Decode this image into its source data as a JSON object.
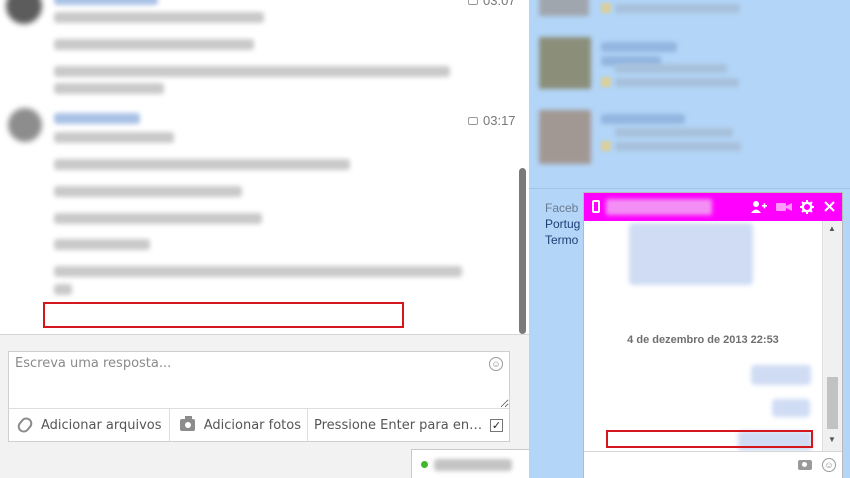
{
  "conversation": {
    "messages": [
      {
        "timestamp": "03:07"
      },
      {
        "timestamp": "03:17"
      }
    ]
  },
  "composer": {
    "placeholder": "Escreva uma resposta...",
    "attach_label": "Adicionar arquivos",
    "photo_label": "Adicionar fotos",
    "enter_label": "Pressione Enter para enviar",
    "enter_checked": "✓"
  },
  "sidebar": {
    "footer": {
      "line1": "Faceb",
      "line2": "Portug",
      "line3": "Termo"
    }
  },
  "chat_popup": {
    "date_separator": "4 de dezembro de 2013 22:53",
    "header_color": "#ff00ff"
  },
  "icons": [
    "chat-bubble-icon",
    "paperclip-icon",
    "camera-icon",
    "checkbox-icon",
    "emoji-icon",
    "phone-icon",
    "add-friend-icon",
    "video-icon",
    "gear-icon",
    "close-icon"
  ],
  "colors": {
    "sidebar_bg": "#b3d5f7",
    "highlight_red": "#d3171d",
    "online_green": "#42b72a"
  }
}
